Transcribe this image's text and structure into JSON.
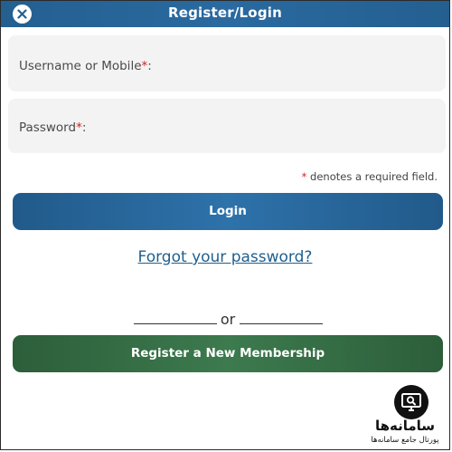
{
  "header": {
    "title": "Register/Login"
  },
  "form": {
    "username_label": "Username or Mobile",
    "password_label": "Password",
    "required_marker": "*",
    "label_suffix": ":",
    "required_note": "denotes a required field.",
    "login_label": "Login",
    "forgot_label": "Forgot your password?",
    "or_label": "or",
    "register_label": "Register a New Membership"
  },
  "watermark": {
    "name": "سامانه‌ها",
    "subtitle": "پورتال جامع سامانه‌ها"
  },
  "colors": {
    "header_blue": "#2a6aa0",
    "login_blue": "#2e72aa",
    "register_green": "#3d7a4e",
    "required_red": "#d32020",
    "link_blue": "#1f5f8f"
  }
}
